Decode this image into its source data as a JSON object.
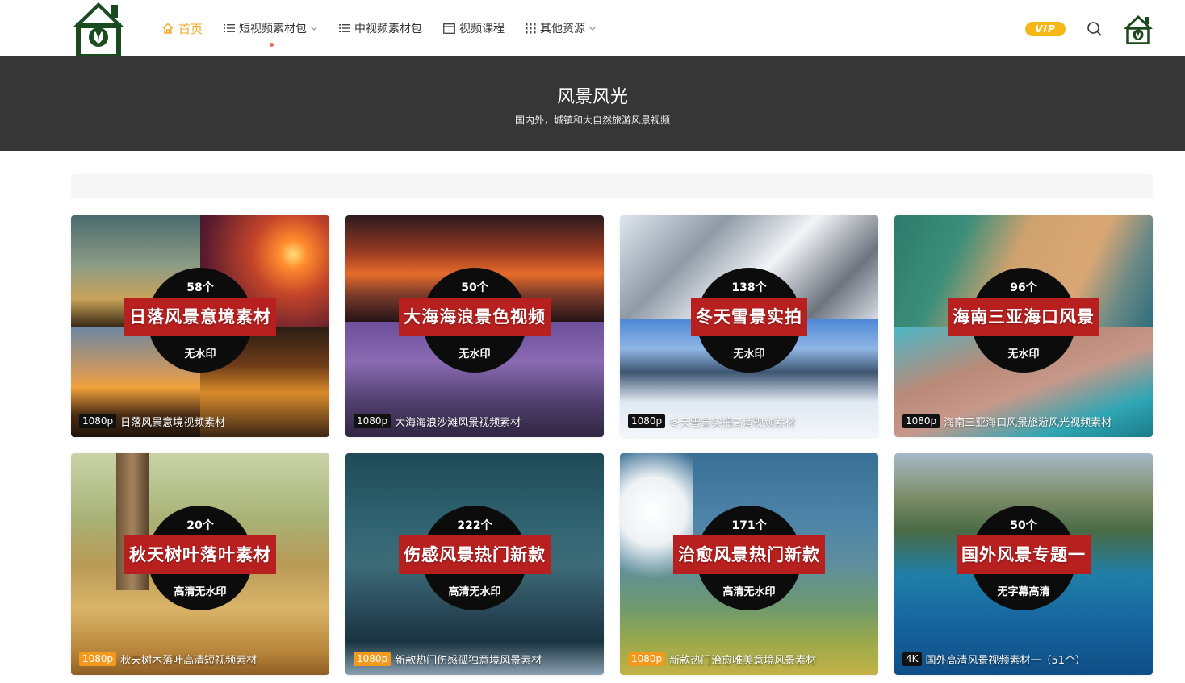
{
  "nav": {
    "items": [
      {
        "label": "首页",
        "icon": "home-icon",
        "active": true
      },
      {
        "label": "短视频素材包",
        "icon": "list-icon",
        "dropdown": true
      },
      {
        "label": "中视频素材包",
        "icon": "list-icon"
      },
      {
        "label": "视频课程",
        "icon": "window-icon"
      },
      {
        "label": "其他资源",
        "icon": "grid-icon",
        "dropdown": true
      }
    ],
    "vip_label": "VIP"
  },
  "banner": {
    "title": "风景风光",
    "subtitle": "国内外，城镇和大自然旅游风景视频"
  },
  "cards": [
    {
      "count": "58个",
      "ribbon": "日落风景意境素材",
      "tag": "无水印",
      "badge": "1080p",
      "badge_color": "#111111",
      "caption": "日落风景意境视频素材"
    },
    {
      "count": "50个",
      "ribbon": "大海海浪景色视频",
      "tag": "无水印",
      "badge": "1080p",
      "badge_color": "#111111",
      "caption": "大海海浪沙滩风景视频素材"
    },
    {
      "count": "138个",
      "ribbon": "冬天雪景实拍",
      "tag": "无水印",
      "badge": "1080p",
      "badge_color": "#111111",
      "caption": "冬天雪景实拍高清视频素材"
    },
    {
      "count": "96个",
      "ribbon": "海南三亚海口风景",
      "tag": "无水印",
      "badge": "1080p",
      "badge_color": "#111111",
      "caption": "海南三亚海口风景旅游风光视频素材"
    },
    {
      "count": "20个",
      "ribbon": "秋天树叶落叶素材",
      "tag": "高清无水印",
      "badge": "1080p",
      "badge_color": "#f39a1e",
      "caption": "秋天树木落叶高清短视频素材"
    },
    {
      "count": "222个",
      "ribbon": "伤感风景热门新款",
      "tag": "高清无水印",
      "badge": "1080p",
      "badge_color": "#f39a1e",
      "caption": "新款热门伤感孤独意境风景素材"
    },
    {
      "count": "171个",
      "ribbon": "治愈风景热门新款",
      "tag": "高清无水印",
      "badge": "1080p",
      "badge_color": "#f39a1e",
      "caption": "新款热门治愈唯美意境风景素材"
    },
    {
      "count": "50个",
      "ribbon": "国外风景专题一",
      "tag": "无字幕高清",
      "badge": "4K",
      "badge_color": "#111111",
      "caption": "国外高清风景视频素材一（51个）"
    }
  ]
}
